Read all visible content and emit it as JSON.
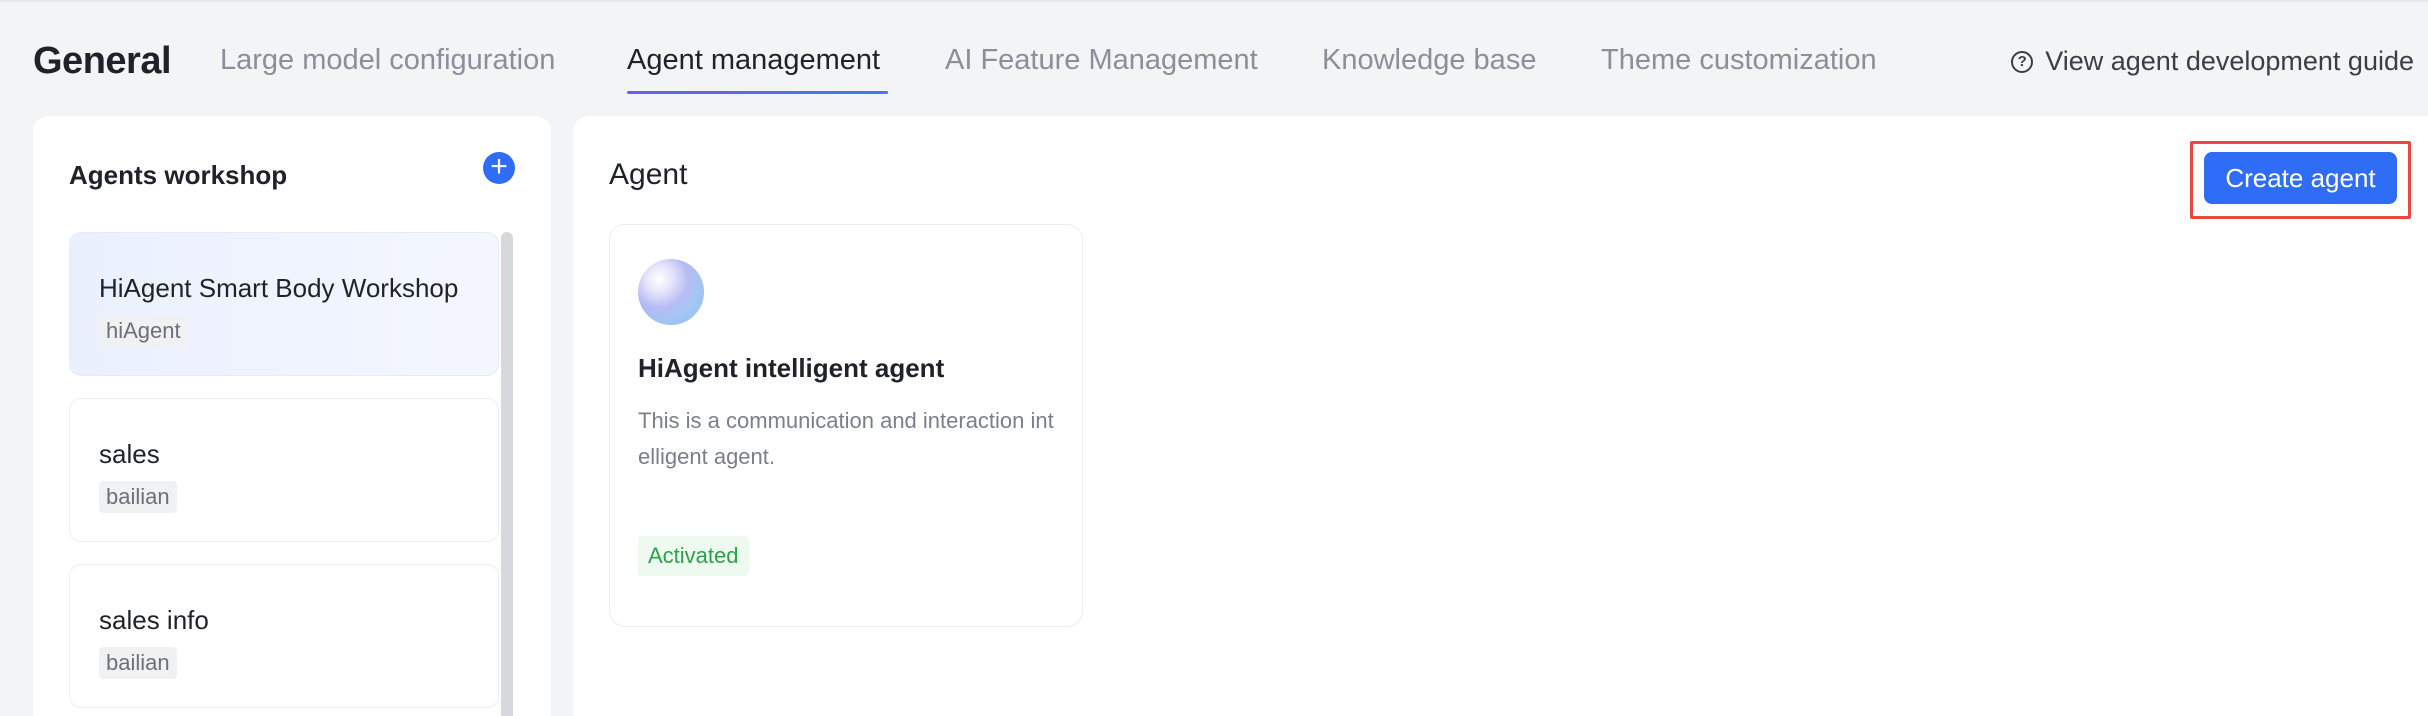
{
  "header": {
    "title": "General",
    "tabs": [
      {
        "label": "Large model configuration",
        "active": false
      },
      {
        "label": "Agent management",
        "active": true
      },
      {
        "label": "AI Feature Management",
        "active": false
      },
      {
        "label": "Knowledge base",
        "active": false
      },
      {
        "label": "Theme customization",
        "active": false
      }
    ],
    "guide_link": "View agent development guide"
  },
  "sidebar": {
    "title": "Agents workshop",
    "add_icon": "plus-circle-icon",
    "items": [
      {
        "name": "HiAgent Smart Body Workshop",
        "tag": "hiAgent",
        "selected": true
      },
      {
        "name": "sales",
        "tag": "bailian",
        "selected": false
      },
      {
        "name": "sales info",
        "tag": "bailian",
        "selected": false
      }
    ]
  },
  "main": {
    "title": "Agent",
    "create_button": "Create agent",
    "cards": [
      {
        "title": "HiAgent intelligent agent",
        "description": "This is a communication and interaction int elligent agent.",
        "status": "Activated"
      }
    ]
  },
  "colors": {
    "accent": "#2f6df6",
    "highlight": "#e8493e",
    "status_green": "#2ba24c"
  }
}
